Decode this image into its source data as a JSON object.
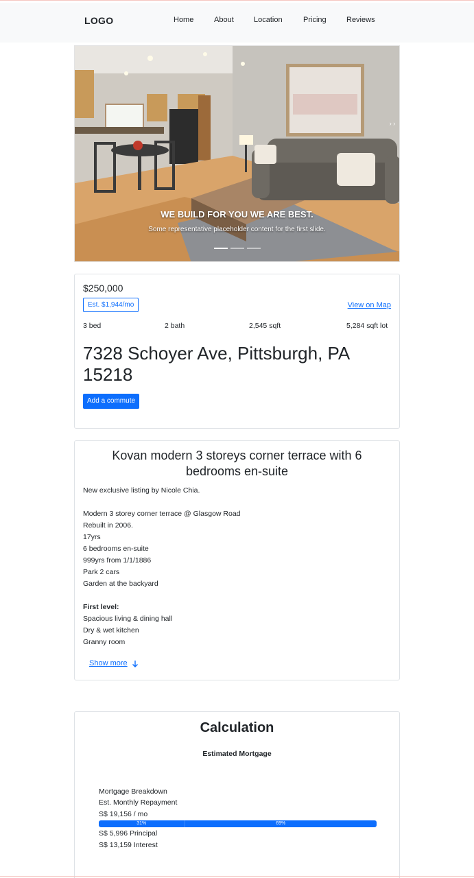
{
  "navbar": {
    "logo": "LOGO",
    "links": [
      "Home",
      "About",
      "Location",
      "Pricing",
      "Reviews"
    ]
  },
  "carousel": {
    "caption_title": "WE BUILD FOR YOU WE ARE BEST.",
    "caption_text": "Some representative placeholder content for the first slide.",
    "next_label": "› ›"
  },
  "listing": {
    "price": "$250,000",
    "estimate": "Est. $1,944/mo",
    "map_link": "View on Map",
    "beds": "3 bed",
    "baths": "2 bath",
    "sqft": "2,545 sqft",
    "lot": "5,284 sqft lot",
    "address": "7328 Schoyer Ave, Pittsburgh, PA 15218",
    "commute_button": "Add a commute"
  },
  "description": {
    "title": "Kovan modern 3 storeys corner terrace with 6 bedrooms en-suite",
    "lines": [
      "New exclusive listing by Nicole Chia.",
      "",
      "Modern 3 storey corner terrace @ Glasgow Road",
      "Rebuilt in 2006.",
      "17yrs",
      "6 bedrooms en-suite",
      "999yrs from 1/1/1886",
      "Park 2 cars",
      "Garden at the backyard",
      "",
      "First level:",
      "Spacious living & dining hall",
      "Dry & wet kitchen",
      "Granny room"
    ],
    "show_more": "Show more"
  },
  "calculation": {
    "title": "Calculation",
    "subtitle": "Estimated Mortgage",
    "breakdown_label": "Mortgage Breakdown",
    "monthly_label": "Est. Monthly Repayment",
    "monthly_value": "S$ 19,156 / mo",
    "principal_pct_label": "31%",
    "interest_pct_label": "69%",
    "principal_fraction": 0.31,
    "interest_fraction": 0.69,
    "principal": "S$ 5,996 Principal",
    "interest": "S$ 13,159 Interest"
  },
  "colors": {
    "accent": "#0d6efd",
    "navbar_bg": "#f8f9fa",
    "border": "#dee2e6"
  }
}
